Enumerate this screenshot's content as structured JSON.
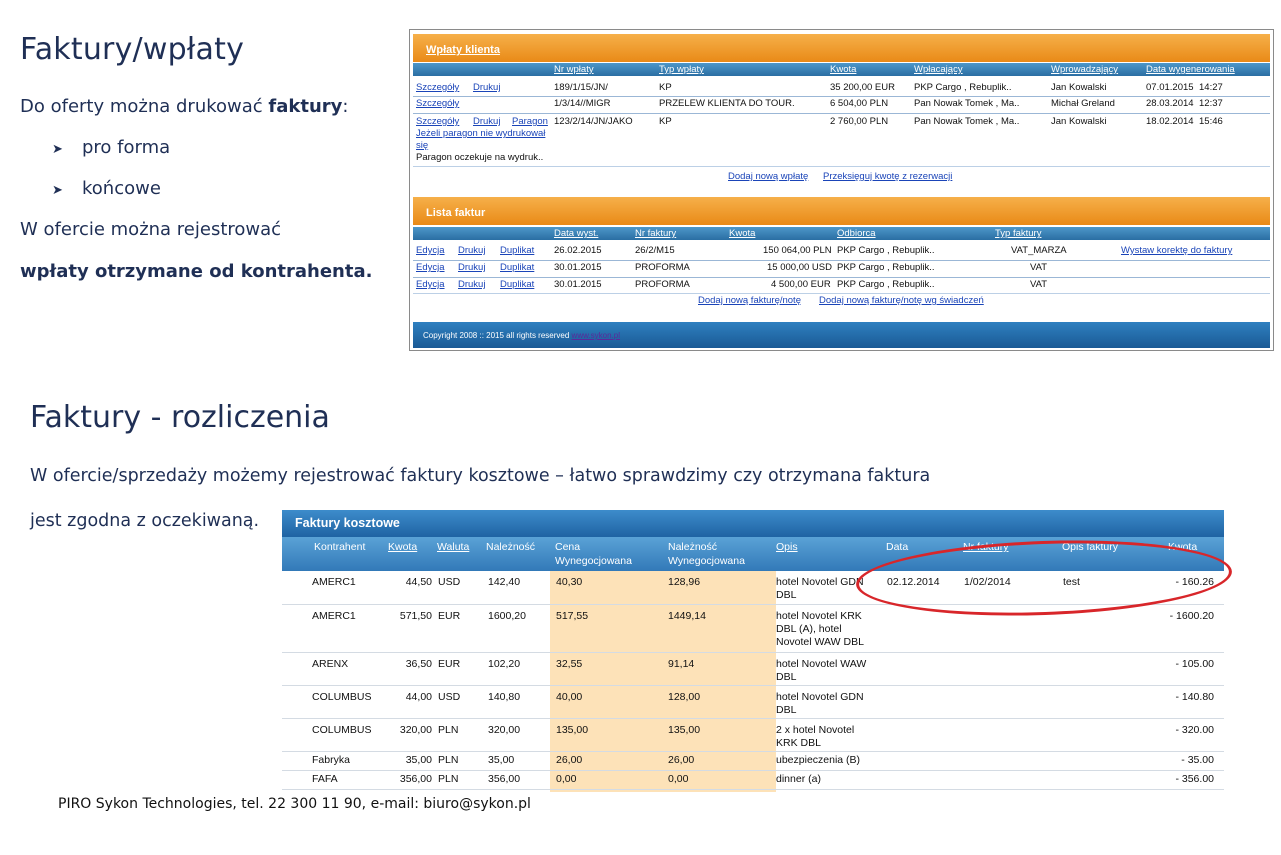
{
  "slide": {
    "title1": "Faktury/wpłaty",
    "intro_pre": "Do oferty można drukować ",
    "intro_bold": "faktury",
    "intro_post": ":",
    "bullets": [
      "pro forma",
      "końcowe"
    ],
    "para2": "W ofercie można rejestrować",
    "para3_bold": "wpłaty",
    "para3_rest": " otrzymane od kontrahenta.",
    "title2": "Faktury - rozliczenia",
    "para4": "W ofercie/sprzedaży możemy rejestrować faktury kosztowe – łatwo sprawdzimy czy otrzymana faktura",
    "para5": "jest zgodna z oczekiwaną.",
    "footer": "PIRO Sykon Technologies, tel. 22 300 11 90, e-mail: biuro@sykon.pl"
  },
  "payments": {
    "title": "Wpłaty klienta",
    "columns": [
      "Nr wpłaty",
      "Typ wpłaty",
      "Kwota",
      "Wpłacający",
      "Wprowadzający",
      "Data wygenerowania"
    ],
    "rows": [
      {
        "links": [
          "Szczegóły",
          "Drukuj"
        ],
        "nr": "189/1/15/JN/",
        "typ": "KP",
        "kwota": "35 200,00 EUR",
        "wplacajacy": "PKP Cargo , Rebuplik..",
        "wprowadzajacy": "Jan Kowalski",
        "data": "07.01.2015",
        "time": "14:27"
      },
      {
        "links": [
          "Szczegóły"
        ],
        "nr": "1/3/14//MIGR",
        "typ": "PRZELEW KLIENTA DO TOUR.",
        "kwota": "6 504,00 PLN",
        "wplacajacy": "Pan Nowak Tomek , Ma..",
        "wprowadzajacy": "Michał Greland",
        "data": "28.03.2014",
        "time": "12:37"
      },
      {
        "links": [
          "Szczegóły",
          "Drukuj",
          "Paragon"
        ],
        "nr": "123/2/14/JN/JAKO",
        "typ": "KP",
        "kwota": "2 760,00 PLN",
        "wplacajacy": "Pan Nowak Tomek , Ma..",
        "wprowadzajacy": "Jan Kowalski",
        "data": "18.02.2014",
        "time": "15:46",
        "note_link_1": "Jeżeli paragon nie wydrukował",
        "note_link_2": "się",
        "note": "Paragon oczekuje na wydruk.."
      }
    ],
    "actions": [
      "Dodaj nową wpłatę",
      "Przeksięguj kwotę z rezerwacji"
    ]
  },
  "invoices": {
    "title": "Lista faktur",
    "columns": [
      "Data wyst.",
      "Nr faktury",
      "Kwota",
      "Odbiorca",
      "Typ faktury"
    ],
    "rows": [
      {
        "links": [
          "Edycja",
          "Drukuj",
          "Duplikat"
        ],
        "data": "26.02.2015",
        "nr": "26/2/M15",
        "kwota": "150 064,00 PLN",
        "odbiorca": "PKP Cargo , Rebuplik..",
        "typ": "VAT_MARZA",
        "extra": "Wystaw korektę do faktury"
      },
      {
        "links": [
          "Edycja",
          "Drukuj",
          "Duplikat"
        ],
        "data": "30.01.2015",
        "nr": "PROFORMA",
        "kwota": "15 000,00 USD",
        "odbiorca": "PKP Cargo , Rebuplik..",
        "typ": "VAT",
        "extra": ""
      },
      {
        "links": [
          "Edycja",
          "Drukuj",
          "Duplikat"
        ],
        "data": "30.01.2015",
        "nr": "PROFORMA",
        "kwota": "4 500,00 EUR",
        "odbiorca": "PKP Cargo , Rebuplik..",
        "typ": "VAT",
        "extra": ""
      }
    ],
    "actions": [
      "Dodaj nową fakturę/notę",
      "Dodaj nową fakturę/notę wg świadczeń"
    ],
    "copyright": "Copyright 2008 :: 2015 all rights reserved",
    "copyright_link": "www.sykon.pl"
  },
  "cost_invoices": {
    "title": "Faktury kosztowe",
    "columns": {
      "kontrahent": "Kontrahent",
      "kwota": "Kwota",
      "waluta": "Waluta",
      "naleznosc": "Należność",
      "cena_1": "Cena",
      "cena_2": "Wynegocjowana",
      "nal_wyn_1": "Należność",
      "nal_wyn_2": "Wynegocjowana",
      "opis": "Opis",
      "data": "Data",
      "nr_faktury": "Nr faktury",
      "opis_faktury": "Opis faktury",
      "kwota2": "Kwota"
    },
    "rows": [
      {
        "kontrahent": "AMERC1",
        "kwota": "44,50",
        "waluta": "USD",
        "naleznosc": "142,40",
        "cena": "40,30",
        "nal_wyn": "128,96",
        "opis": "hotel Novotel GDN DBL",
        "data": "02.12.2014",
        "nr": "1/02/2014",
        "opis_f": "test",
        "kwota2": "- 160.26"
      },
      {
        "kontrahent": "AMERC1",
        "kwota": "571,50",
        "waluta": "EUR",
        "naleznosc": "1600,20",
        "cena": "517,55",
        "nal_wyn": "1449,14",
        "opis": "hotel Novotel KRK DBL (A), hotel Novotel WAW DBL",
        "data": "",
        "nr": "",
        "opis_f": "",
        "kwota2": "- 1600.20"
      },
      {
        "kontrahent": "ARENX",
        "kwota": "36,50",
        "waluta": "EUR",
        "naleznosc": "102,20",
        "cena": "32,55",
        "nal_wyn": "91,14",
        "opis": "hotel Novotel WAW DBL",
        "data": "",
        "nr": "",
        "opis_f": "",
        "kwota2": "- 105.00"
      },
      {
        "kontrahent": "COLUMBUS",
        "kwota": "44,00",
        "waluta": "USD",
        "naleznosc": "140,80",
        "cena": "40,00",
        "nal_wyn": "128,00",
        "opis": "hotel Novotel GDN DBL",
        "data": "",
        "nr": "",
        "opis_f": "",
        "kwota2": "- 140.80"
      },
      {
        "kontrahent": "COLUMBUS",
        "kwota": "320,00",
        "waluta": "PLN",
        "naleznosc": "320,00",
        "cena": "135,00",
        "nal_wyn": "135,00",
        "opis": "2 x hotel Novotel KRK DBL",
        "data": "",
        "nr": "",
        "opis_f": "",
        "kwota2": "- 320.00"
      },
      {
        "kontrahent": "Fabryka",
        "kwota": "35,00",
        "waluta": "PLN",
        "naleznosc": "35,00",
        "cena": "26,00",
        "nal_wyn": "26,00",
        "opis": "ubezpieczenia (B)",
        "data": "",
        "nr": "",
        "opis_f": "",
        "kwota2": "- 35.00"
      },
      {
        "kontrahent": "FAFA",
        "kwota": "356,00",
        "waluta": "PLN",
        "naleznosc": "356,00",
        "cena": "0,00",
        "nal_wyn": "0,00",
        "opis": "dinner (a)",
        "data": "",
        "nr": "",
        "opis_f": "",
        "kwota2": "- 356.00"
      }
    ]
  },
  "colors": {
    "orange": "#e98a17",
    "blue": "#2a6ea3",
    "peach": "#fde2b8",
    "highlight_ellipse": "#d8262a",
    "link": "#1a44b8"
  }
}
